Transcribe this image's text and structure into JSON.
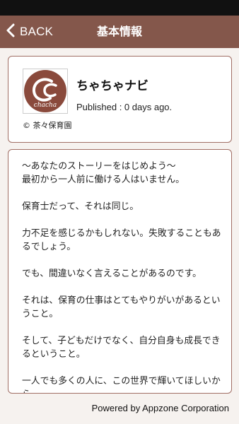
{
  "nav": {
    "back_label": "BACK",
    "title": "基本情報"
  },
  "app": {
    "name": "ちゃちゃナビ",
    "logo_text": "chacha",
    "published": "Published : 0 days ago.",
    "copyright": "© 茶々保育園"
  },
  "description": "〜あなたのストーリーをはじめよう〜\n最初から一人前に働ける人はいません。\n\n保育士だって、それは同じ。\n\n力不足を感じるかもしれない。失敗することもあるでしょう。\n\nでも、間違いなく言えることがあるのです。\n\nそれは、保育の仕事はとてもやりがいがあるということ。\n\nそして、子どもだけでなく、自分自身も成長できるということ。\n\n一人でも多くの人に、この世界で輝いてほしいから、\n\n私たちはスタートラインに立つあなたを応援します。",
  "footer": "Powered by Appzone Corporation",
  "colors": {
    "accent": "#84574b",
    "border": "#a06e64",
    "background": "#f6f2ef"
  }
}
